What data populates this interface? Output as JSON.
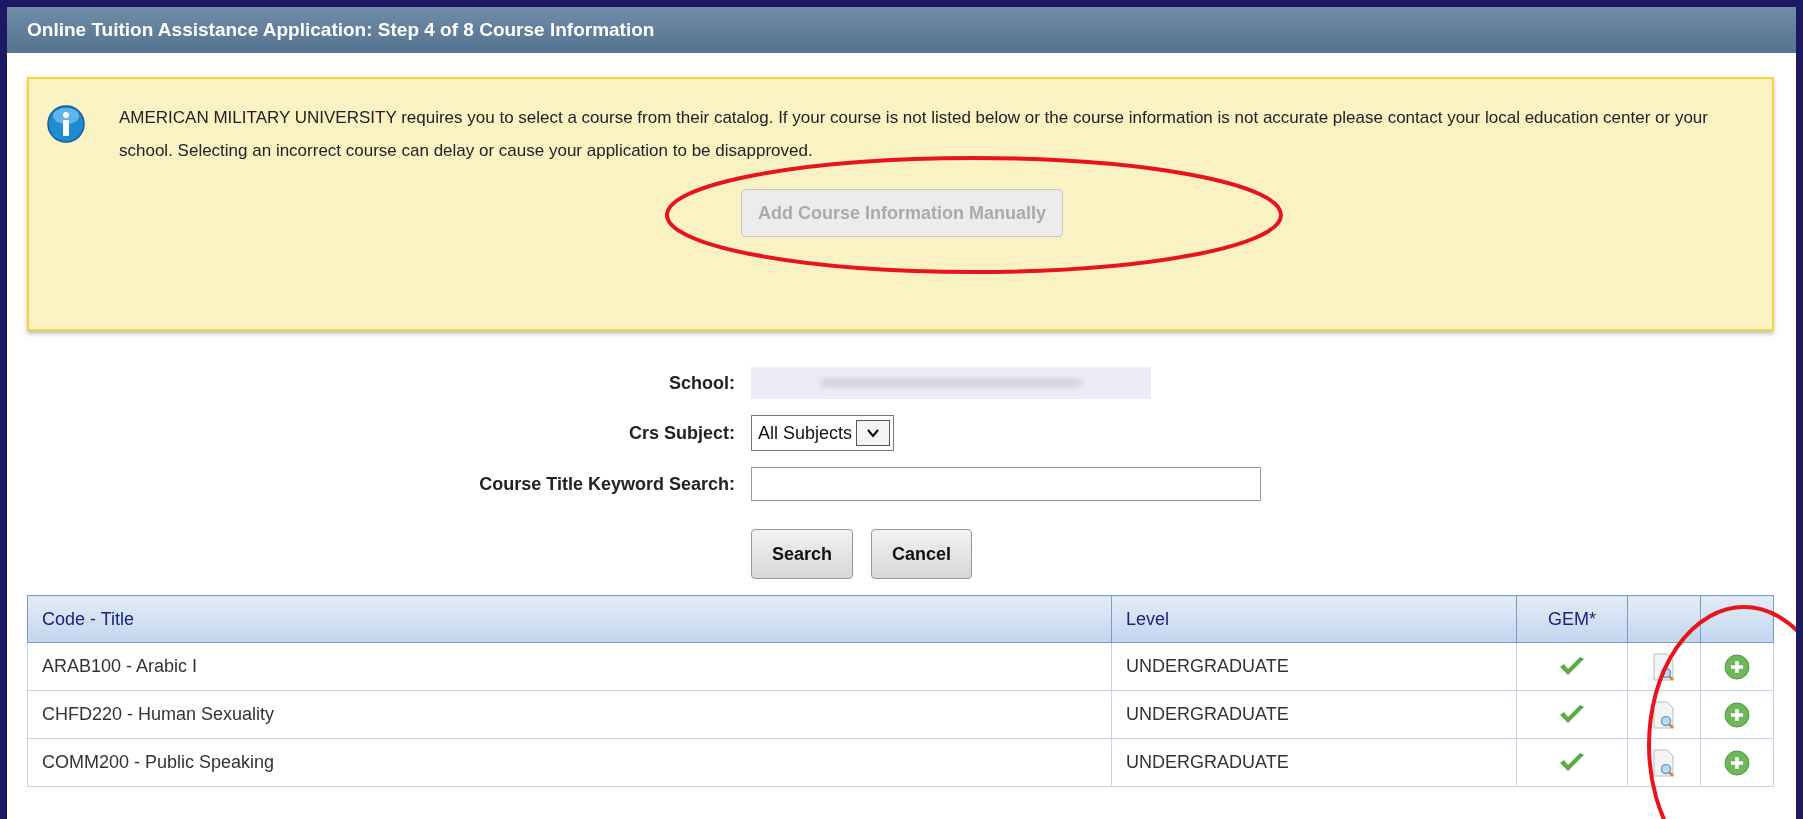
{
  "header": {
    "title": "Online Tuition Assistance Application: Step 4 of 8 Course Information"
  },
  "notice": {
    "message": "AMERICAN MILITARY UNIVERSITY requires you to select a course from their catalog. If your course is not listed below or the course information is not accurate please contact your local education center or your school. Selecting an incorrect course can delay or cause your application to be disapproved.",
    "button": {
      "label": "Add Course Information Manually",
      "disabled": true
    }
  },
  "form": {
    "school_label": "School:",
    "subject_label": "Crs Subject:",
    "subject_value": "All Subjects",
    "keyword_label": "Course Title Keyword Search:",
    "buttons": [
      "Search",
      "Cancel"
    ]
  },
  "table": {
    "columns": [
      "Code - Title",
      "Level",
      "GEM*"
    ],
    "rows": [
      {
        "code_title": "ARAB100 - Arabic I",
        "level": "UNDERGRADUATE",
        "gem": true
      },
      {
        "code_title": "CHFD220 - Human Sexuality",
        "level": "UNDERGRADUATE",
        "gem": true
      },
      {
        "code_title": "COMM200 - Public Speaking",
        "level": "UNDERGRADUATE",
        "gem": true
      }
    ]
  }
}
